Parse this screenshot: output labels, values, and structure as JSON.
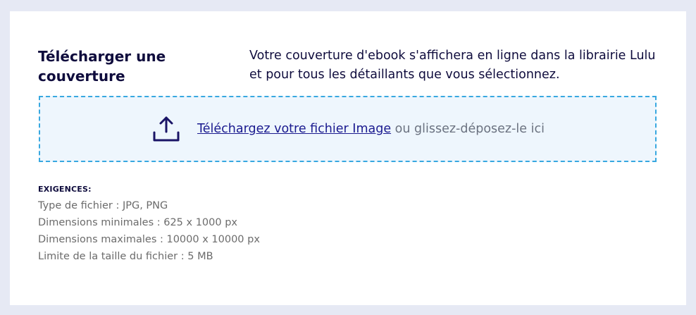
{
  "header": {
    "title": "Télécharger une couverture",
    "description": "Votre couverture d'ebook s'affichera en ligne dans la librairie Lulu et pour tous les détaillants que vous sélectionnez."
  },
  "dropzone": {
    "icon": "upload-icon",
    "link_label": "Téléchargez votre fichier Image",
    "suffix": " ou glissez-déposez-le ici"
  },
  "requirements": {
    "heading": "EXIGENCES:",
    "items": [
      "Type de fichier : JPG, PNG",
      "Dimensions minimales : 625 x 1000 px",
      "Dimensions maximales : 10000 x 10000 px",
      "Limite de la taille du fichier : 5 MB"
    ]
  },
  "colors": {
    "page_background": "#e6e9f4",
    "dropzone_background": "#eef6fd",
    "dropzone_border": "#38a8e0",
    "text_dark": "#0f0c3d",
    "link": "#1a1a8f"
  }
}
